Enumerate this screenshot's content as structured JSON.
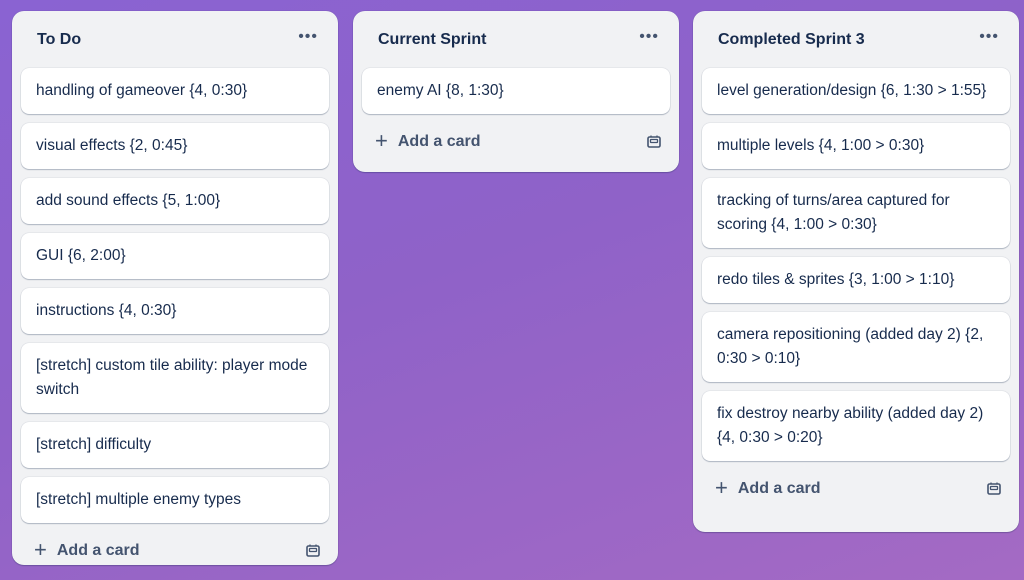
{
  "lists": [
    {
      "title": "To Do",
      "cards": [
        "handling of gameover {4, 0:30}",
        "visual effects {2, 0:45}",
        "add sound effects {5, 1:00}",
        "GUI {6, 2:00}",
        "instructions {4, 0:30}",
        "[stretch] custom tile ability: player mode switch",
        "[stretch] difficulty",
        "[stretch] multiple enemy types"
      ],
      "add_label": "Add a card"
    },
    {
      "title": "Current Sprint",
      "cards": [
        "enemy AI {8, 1:30}"
      ],
      "add_label": "Add a card"
    },
    {
      "title": "Completed Sprint 3",
      "cards": [
        "level generation/design {6, 1:30 > 1:55}",
        "multiple levels {4, 1:00 > 0:30}",
        "tracking of turns/area captured for scoring {4, 1:00 > 0:30}",
        "redo tiles & sprites {3, 1:00 > 1:10}",
        "camera repositioning (added day 2) {2, 0:30 > 0:10}",
        "fix destroy nearby ability (added day 2) {4, 0:30 > 0:20}"
      ],
      "add_label": "Add a card"
    }
  ],
  "icons": {
    "list_menu": "more-horizontal-icon",
    "add": "plus-icon",
    "template": "card-template-icon"
  },
  "colors": {
    "background_start": "#8a63d2",
    "background_end": "#a46ac4",
    "list_bg": "#f1f2f4",
    "card_bg": "#ffffff",
    "text": "#172b4d",
    "subtle_text": "#44546f"
  }
}
